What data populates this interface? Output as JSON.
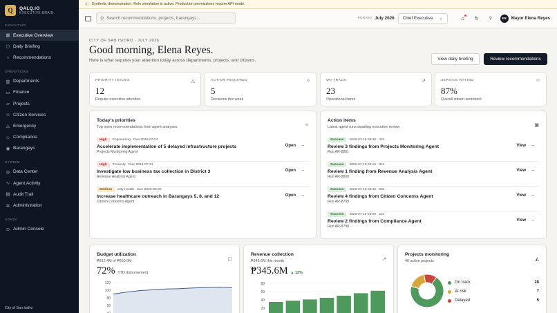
{
  "brand": {
    "name": "QALQ.IO",
    "subtitle": "EXECUTIVE BRAIN",
    "logo_letter": "Q"
  },
  "sidebar": {
    "sections": [
      {
        "label": "EXECUTIVE",
        "items": [
          {
            "label": "Executive Overview",
            "icon": "grid-icon",
            "glyph": "▦",
            "active": true
          },
          {
            "label": "Daily Briefing",
            "icon": "calendar-icon",
            "glyph": "▢"
          },
          {
            "label": "Recommendations",
            "icon": "lightbulb-icon",
            "glyph": "♁"
          }
        ]
      },
      {
        "label": "OPERATIONS",
        "items": [
          {
            "label": "Departments",
            "icon": "building-icon",
            "glyph": "▥"
          },
          {
            "label": "Finance",
            "icon": "wallet-icon",
            "glyph": "▭"
          },
          {
            "label": "Projects",
            "icon": "folder-icon",
            "glyph": "▱"
          },
          {
            "label": "Citizen Services",
            "icon": "users-icon",
            "glyph": "☺"
          },
          {
            "label": "Emergency",
            "icon": "alert-icon",
            "glyph": "△"
          },
          {
            "label": "Compliance",
            "icon": "shield-icon",
            "glyph": "◇"
          },
          {
            "label": "Barangays",
            "icon": "map-pin-icon",
            "glyph": "◉"
          }
        ]
      },
      {
        "label": "SYSTEM",
        "items": [
          {
            "label": "Data Center",
            "icon": "database-icon",
            "glyph": "◎"
          },
          {
            "label": "Agent Activity",
            "icon": "activity-icon",
            "glyph": "∿"
          },
          {
            "label": "Audit Trail",
            "icon": "file-icon",
            "glyph": "▤"
          },
          {
            "label": "Administration",
            "icon": "gear-icon",
            "glyph": "✲"
          }
        ]
      },
      {
        "label": "ADMIN",
        "items": [
          {
            "label": "Admin Console",
            "icon": "console-icon",
            "glyph": "⊙"
          }
        ]
      }
    ],
    "footer": "City of San Isidro"
  },
  "banner": {
    "text": "Synthetic demonstration: Role simulation is active. Production permissions require API mode."
  },
  "topbar": {
    "search_placeholder": "Search recommendations, projects, barangays...",
    "period_label": "PERIOD",
    "period_value": "July 2026",
    "role_value": "Chief Executive",
    "avatar_initials": "ER",
    "user_name": "Mayor Elena Reyes"
  },
  "header": {
    "eyebrow": "CITY OF SAN ISIDRO · JULY 2026",
    "greeting": "Good morning, Elena Reyes.",
    "subtitle": "Here is what requires your attention today across departments, projects, and citizens.",
    "btn_briefing": "View daily briefing",
    "btn_review": "Review recommendations"
  },
  "kpis": [
    {
      "label": "PRIORITY ISSUES",
      "value": "12",
      "sub": "Require executive attention",
      "icon": "alert-icon",
      "glyph": "△"
    },
    {
      "label": "ACTION REQUIRED",
      "value": "5",
      "sub": "Decisions this week",
      "icon": "sparkle-icon",
      "glyph": "✧"
    },
    {
      "label": "ON TRACK",
      "value": "23",
      "sub": "Operational items",
      "icon": "trend-up-icon",
      "glyph": "↗"
    },
    {
      "label": "SERVICE RATING",
      "value": "87%",
      "sub": "Overall citizen sentiment",
      "icon": "users-icon",
      "glyph": "☺"
    }
  ],
  "priorities": {
    "title": "Today's priorities",
    "subtitle": "Top open recommendations from agent analyses",
    "action_label": "Open",
    "items": [
      {
        "badge": "High",
        "level": "high",
        "meta": "Engineering · Due 2026-07-24",
        "title": "Accelerate implementation of 5 delayed infrastructure projects",
        "source": "Projects Monitoring Agent"
      },
      {
        "badge": "High",
        "level": "high",
        "meta": "Treasury · Due 2026-07-31",
        "title": "Investigate low business tax collection in District 3",
        "source": "Revenue Analysis Agent"
      },
      {
        "badge": "Medium",
        "level": "med",
        "meta": "City Health · Due 2026-08-05",
        "title": "Increase healthcare outreach in Barangays 5, 8, and 12",
        "source": "Citizen Concerns Agent"
      }
    ]
  },
  "actions": {
    "title": "Action items",
    "subtitle": "Latest agent runs awaiting executive review",
    "action_label": "View",
    "items": [
      {
        "badge": "Success",
        "meta": "2026-07-18 05:30 · 42s",
        "title": "Review 3 findings from Projects Monitoring Agent",
        "run": "Run AR-8801"
      },
      {
        "badge": "Success",
        "meta": "2026-07-18 05:15 · 31s",
        "title": "Review 1 finding from Revenue Analysis Agent",
        "run": "Run AR-8800"
      },
      {
        "badge": "Success",
        "meta": "2026-07-18 05:45 · 58s",
        "title": "Review 4 findings from Citizen Concerns Agent",
        "run": "Run AR-8799"
      },
      {
        "badge": "Success",
        "meta": "2026-07-18 06:00 · 22s",
        "title": "Review 2 findings from Compliance Agent",
        "run": "Run AR-8798"
      }
    ]
  },
  "budget": {
    "title": "Budget utilization",
    "subtitle": "₱812.4M of ₱650.0M",
    "value": "72%",
    "note": "YTD disbursement"
  },
  "revenue": {
    "title": "Revenue collection",
    "subtitle": "₱345.6M this month",
    "value": "₱345.6M",
    "trend": "▲ 12%"
  },
  "projects": {
    "title": "Projects monitoring",
    "subtitle": "40 active projects",
    "legend": [
      {
        "label": "On track",
        "value": "28",
        "color": "#4e9a5c"
      },
      {
        "label": "At risk",
        "value": "7",
        "color": "#d9a53a"
      },
      {
        "label": "Delayed",
        "value": "5",
        "color": "#c9473a"
      }
    ]
  },
  "colors": {
    "accent": "#121a28",
    "success": "#4e9a5c",
    "warning": "#d9a53a",
    "danger": "#c9473a",
    "line": "#3f5d86"
  },
  "chart_data": [
    {
      "type": "area",
      "title": "Budget utilization",
      "y_ticks": [
        "120",
        "100",
        "80",
        "60",
        "40"
      ],
      "ylim": [
        40,
        120
      ],
      "values": [
        90,
        95,
        99,
        101,
        103,
        104,
        106,
        107,
        108,
        107
      ]
    },
    {
      "type": "bar",
      "title": "Revenue collection",
      "y_ticks": [
        "80",
        "60",
        "40",
        "20"
      ],
      "ylim": [
        0,
        80
      ],
      "values": [
        35,
        38,
        41,
        45,
        50,
        56,
        62
      ]
    },
    {
      "type": "pie",
      "title": "Projects monitoring",
      "categories": [
        "On track",
        "At risk",
        "Delayed"
      ],
      "values": [
        28,
        7,
        5
      ]
    }
  ]
}
